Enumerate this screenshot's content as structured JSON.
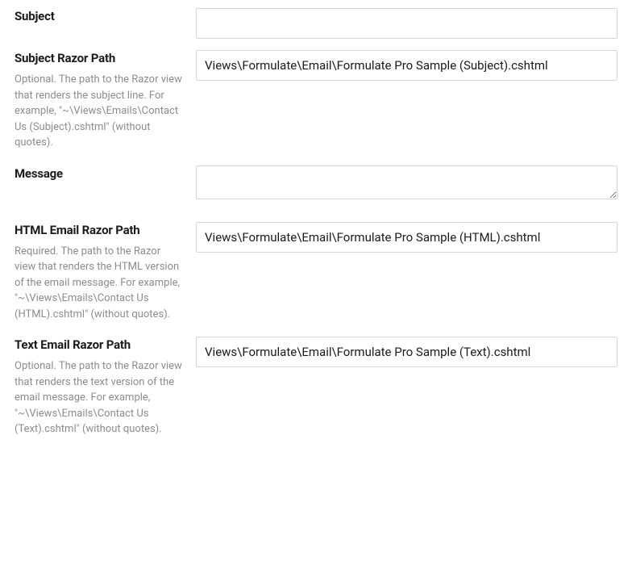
{
  "fields": {
    "subject": {
      "label": "Subject",
      "value": ""
    },
    "subjectRazorPath": {
      "label": "Subject Razor Path",
      "help": "Optional. The path to the Razor view that renders the subject line. For example, \"~\\Views\\Emails\\Contact Us (Subject).cshtml\" (without quotes).",
      "value": "Views\\Formulate\\Email\\Formulate Pro Sample (Subject).cshtml"
    },
    "message": {
      "label": "Message",
      "value": ""
    },
    "htmlRazorPath": {
      "label": "HTML Email Razor Path",
      "help": "Required. The path to the Razor view that renders the HTML version of the email message. For example, \"~\\Views\\Emails\\Contact Us (HTML).cshtml\" (without quotes).",
      "value": "Views\\Formulate\\Email\\Formulate Pro Sample (HTML).cshtml"
    },
    "textRazorPath": {
      "label": "Text Email Razor Path",
      "help": "Optional. The path to the Razor view that renders the text version of the email message. For example, \"~\\Views\\Emails\\Contact Us (Text).cshtml\" (without quotes).",
      "value": "Views\\Formulate\\Email\\Formulate Pro Sample (Text).cshtml"
    }
  }
}
